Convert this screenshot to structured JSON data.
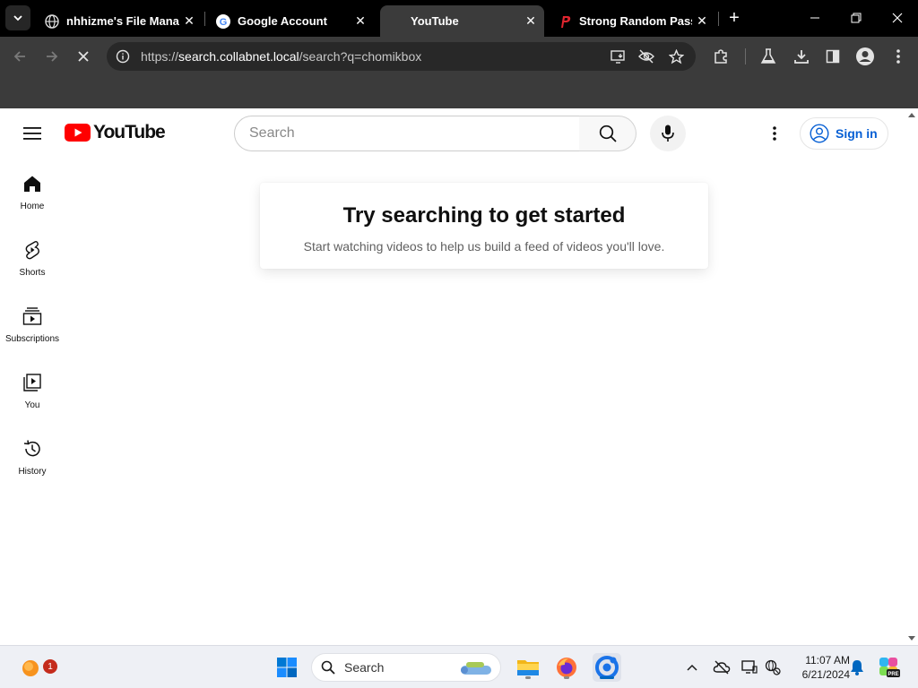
{
  "browser": {
    "tabs": [
      {
        "title": "nhhizme's File Manag",
        "active": false,
        "favicon": "globe-icon"
      },
      {
        "title": "Google Account",
        "active": false,
        "favicon": "google-g-icon"
      },
      {
        "title": "YouTube",
        "active": true,
        "favicon": "youtube-icon"
      },
      {
        "title": "Strong Random Passw",
        "active": false,
        "favicon": "password-p-icon"
      }
    ],
    "url_scheme": "https://",
    "url_host": "search.collabnet.local",
    "url_path": "/search?q=chomikbox"
  },
  "youtube": {
    "logo_text": "YouTube",
    "search_placeholder": "Search",
    "signin_label": "Sign in",
    "guide": [
      {
        "label": "Home",
        "icon": "home-icon"
      },
      {
        "label": "Shorts",
        "icon": "shorts-icon"
      },
      {
        "label": "Subscriptions",
        "icon": "subscriptions-icon"
      },
      {
        "label": "You",
        "icon": "you-icon"
      },
      {
        "label": "History",
        "icon": "history-icon"
      }
    ],
    "prompt_title": "Try searching to get started",
    "prompt_subtitle": "Start watching videos to help us build a feed of videos you'll love."
  },
  "taskbar": {
    "search_label": "Search",
    "notification_count": "1",
    "time": "11:07 AM",
    "date": "6/21/2024"
  },
  "colors": {
    "youtube_red": "#ff0000",
    "link_blue": "#065fd4",
    "chrome_dark": "#3b3b3b"
  }
}
